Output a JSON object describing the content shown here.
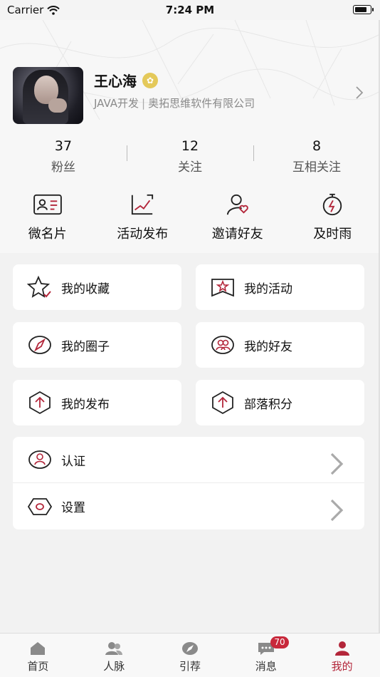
{
  "status_bar": {
    "carrier": "Carrier",
    "time": "7:24 PM"
  },
  "profile": {
    "name": "王心海",
    "role": "JAVA开发",
    "separator": "|",
    "company": "奥拓思维软件有限公司",
    "badge_icon": "clover-badge-icon"
  },
  "stats": [
    {
      "value": "37",
      "label": "粉丝"
    },
    {
      "value": "12",
      "label": "关注"
    },
    {
      "value": "8",
      "label": "互相关注"
    }
  ],
  "quick_actions": [
    {
      "label": "微名片",
      "icon": "id-card-icon"
    },
    {
      "label": "活动发布",
      "icon": "chart-note-icon"
    },
    {
      "label": "邀请好友",
      "icon": "invite-user-icon"
    },
    {
      "label": "及时雨",
      "icon": "stopwatch-icon"
    }
  ],
  "menu_cards": [
    {
      "label": "我的收藏",
      "icon": "star-icon"
    },
    {
      "label": "我的活动",
      "icon": "activity-banner-icon"
    },
    {
      "label": "我的圈子",
      "icon": "compass-icon"
    },
    {
      "label": "我的好友",
      "icon": "friends-icon"
    },
    {
      "label": "我的发布",
      "icon": "publish-icon"
    },
    {
      "label": "部落积分",
      "icon": "points-icon"
    }
  ],
  "settings_list": [
    {
      "label": "认证",
      "icon": "certify-icon"
    },
    {
      "label": "设置",
      "icon": "settings-icon"
    }
  ],
  "tab_bar": [
    {
      "label": "首页",
      "icon": "home-icon"
    },
    {
      "label": "人脉",
      "icon": "contacts-icon"
    },
    {
      "label": "引荐",
      "icon": "compass-icon"
    },
    {
      "label": "消息",
      "icon": "message-icon",
      "badge": "70"
    },
    {
      "label": "我的",
      "icon": "user-icon",
      "active": true
    }
  ],
  "colors": {
    "accent": "#b3263a",
    "badge": "#c8283b",
    "gold": "#e4c95a"
  }
}
